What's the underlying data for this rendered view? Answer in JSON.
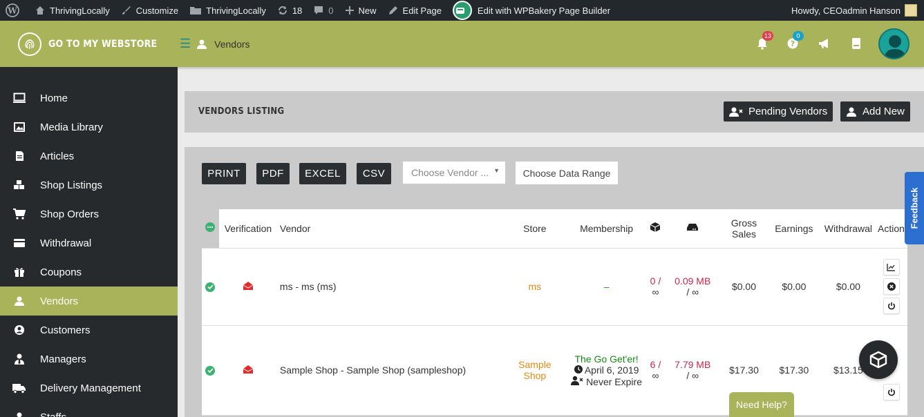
{
  "adminbar": {
    "site_name": "ThrivingLocally",
    "customize": "Customize",
    "site_name_2": "ThrivingLocally",
    "updates": "18",
    "comments": "0",
    "new": "New",
    "edit_page": "Edit Page",
    "wpbakery": "Edit with WPBakery Page Builder",
    "howdy": "Howdy, CEOadmin Hanson"
  },
  "header": {
    "brand": "GO TO MY WEBSTORE",
    "breadcrumb": "Vendors",
    "notifications_count": "13",
    "help_count": "0"
  },
  "sidebar": {
    "items": [
      {
        "label": "Home",
        "icon": "monitor-icon"
      },
      {
        "label": "Media Library",
        "icon": "image-icon"
      },
      {
        "label": "Articles",
        "icon": "file-icon"
      },
      {
        "label": "Shop Listings",
        "icon": "cubes-icon"
      },
      {
        "label": "Shop Orders",
        "icon": "cart-icon"
      },
      {
        "label": "Withdrawal",
        "icon": "credit-card-icon"
      },
      {
        "label": "Coupons",
        "icon": "gift-icon"
      },
      {
        "label": "Vendors",
        "icon": "user-icon",
        "active": true
      },
      {
        "label": "Customers",
        "icon": "user-circle-icon"
      },
      {
        "label": "Managers",
        "icon": "user-tie-icon"
      },
      {
        "label": "Delivery Management",
        "icon": "truck-icon"
      },
      {
        "label": "Staffs",
        "icon": "user-icon"
      }
    ]
  },
  "page": {
    "title": "VENDORS LISTING",
    "pending_vendors": "Pending Vendors",
    "add_new": "Add New"
  },
  "toolbar": {
    "print": "PRINT",
    "pdf": "PDF",
    "excel": "EXCEL",
    "csv": "CSV",
    "vendor_select": "Choose Vendor ...",
    "data_range": "Choose Data Range"
  },
  "table": {
    "headers": {
      "verification": "Verification",
      "vendor": "Vendor",
      "store": "Store",
      "membership": "Membership",
      "gross_sales": "Gross Sales",
      "earnings": "Earnings",
      "withdrawal": "Withdrawal",
      "action": "Action"
    },
    "rows": [
      {
        "vendor": "ms - ms (ms)",
        "store": "ms",
        "membership": "–",
        "products": "0 /",
        "products_limit": "∞",
        "disk": "0.09 MB",
        "disk_limit": "/ ∞",
        "gross": "$0.00",
        "earnings": "$0.00",
        "withdrawal": "$0.00"
      },
      {
        "vendor": "Sample Shop - Sample Shop (sampleshop)",
        "store": "Sample Shop",
        "membership_name": "The Go Get'er!",
        "membership_date": "April 6, 2019",
        "membership_expire": "Never Expire",
        "products": "6 /",
        "products_limit": "∞",
        "disk": "7.79 MB",
        "disk_limit": "/ ∞",
        "gross": "$17.30",
        "earnings": "$17.30",
        "withdrawal": "$13.15"
      }
    ]
  },
  "floating": {
    "feedback": "Feedback",
    "need_help": "Need Help?"
  }
}
